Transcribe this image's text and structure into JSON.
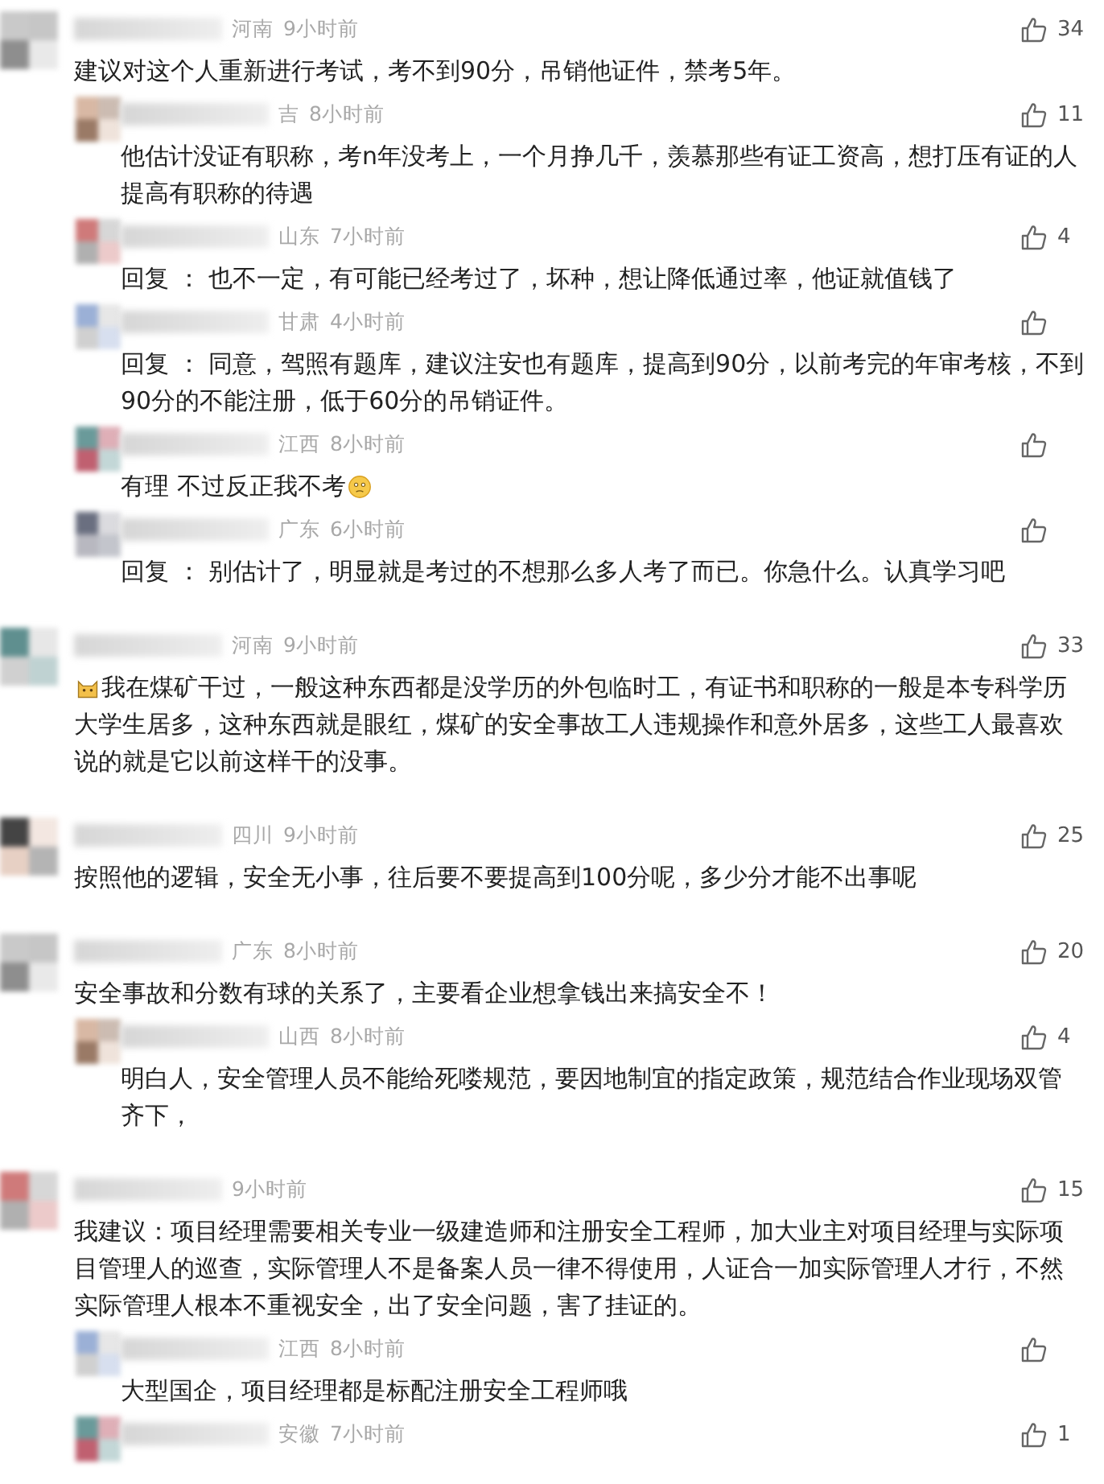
{
  "comments": [
    {
      "region": "河南",
      "time": "9小时前",
      "likes": "34",
      "text": "建议对这个人重新进行考试，考不到90分，吊销他证件，禁考5年。",
      "children": [
        {
          "region": "吉",
          "time": "8小时前",
          "likes": "11",
          "text": "他估计没证有职称，考n年没考上，一个月挣几千，羡慕那些有证工资高，想打压有证的人提高有职称的待遇"
        },
        {
          "region": "山东",
          "time": "7小时前",
          "likes": "4",
          "text": "回复 ： 也不一定，有可能已经考过了，坏种，想让降低通过率，他证就值钱了"
        },
        {
          "region": "甘肃",
          "time": "4小时前",
          "text": "回复 ： 同意，驾照有题库，建议注安也有题库，提高到90分，以前考完的年审考核，不到90分的不能注册，低于60分的吊销证件。"
        },
        {
          "region": "江西",
          "time": "8小时前",
          "text": "有理 不过反正我不考",
          "emoji_after": true
        },
        {
          "region": "广东",
          "time": "6小时前",
          "text": "回复 ： 别估计了，明显就是考过的不想那么多人考了而已。你急什么。认真学习吧"
        }
      ]
    },
    {
      "region": "河南",
      "time": "9小时前",
      "likes": "33",
      "text": "我在煤矿干过，一般这种东西都是没学历的外包临时工，有证书和职称的一般是本专科学历大学生居多，这种东西就是眼红，煤矿的安全事故工人违规操作和意外居多，这些工人最喜欢说的就是它以前这样干的没事。",
      "emoji_before": true
    },
    {
      "region": "四川",
      "time": "9小时前",
      "likes": "25",
      "text": "按照他的逻辑，安全无小事，往后要不要提高到100分呢，多少分才能不出事呢"
    },
    {
      "region": "广东",
      "time": "8小时前",
      "likes": "20",
      "text": "安全事故和分数有球的关系了，主要看企业想拿钱出来搞安全不！",
      "children": [
        {
          "region": "山西",
          "time": "8小时前",
          "likes": "4",
          "text": "明白人，安全管理人员不能给死喽规范，要因地制宜的指定政策，规范结合作业现场双管齐下，"
        }
      ]
    },
    {
      "time": "9小时前",
      "likes": "15",
      "text": "我建议：项目经理需要相关专业一级建造师和注册安全工程师，加大业主对项目经理与实际项目管理人的巡查，实际管理人不是备案人员一律不得使用，人证合一加实际管理人才行，不然实际管理人根本不重视安全，出了安全问题，害了挂证的。",
      "children": [
        {
          "region": "江西",
          "time": "8小时前",
          "text": "大型国企，项目经理都是标配注册安全工程师哦"
        },
        {
          "region": "安徽",
          "time": "7小时前",
          "likes": "1"
        }
      ]
    }
  ]
}
